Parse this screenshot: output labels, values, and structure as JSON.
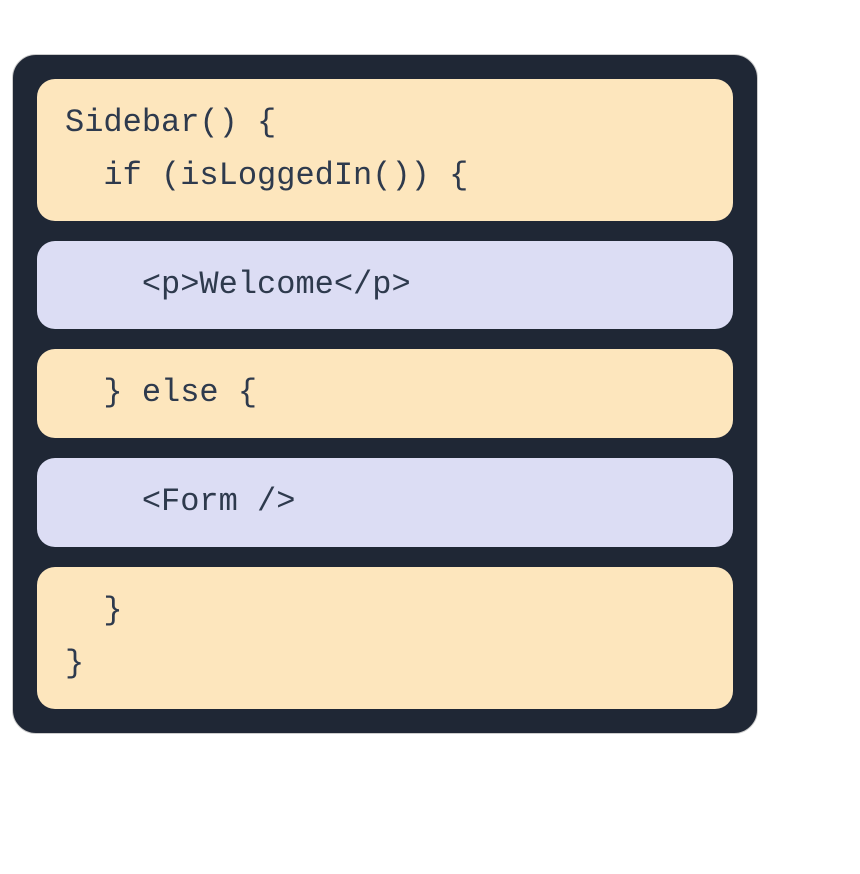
{
  "blocks": [
    {
      "type": "orange",
      "text": "Sidebar() {\n  if (isLoggedIn()) {"
    },
    {
      "type": "blue",
      "text": "    <p>Welcome</p>"
    },
    {
      "type": "orange",
      "text": "  } else {"
    },
    {
      "type": "blue",
      "text": "    <Form />"
    },
    {
      "type": "orange",
      "text": "  }\n}"
    }
  ]
}
